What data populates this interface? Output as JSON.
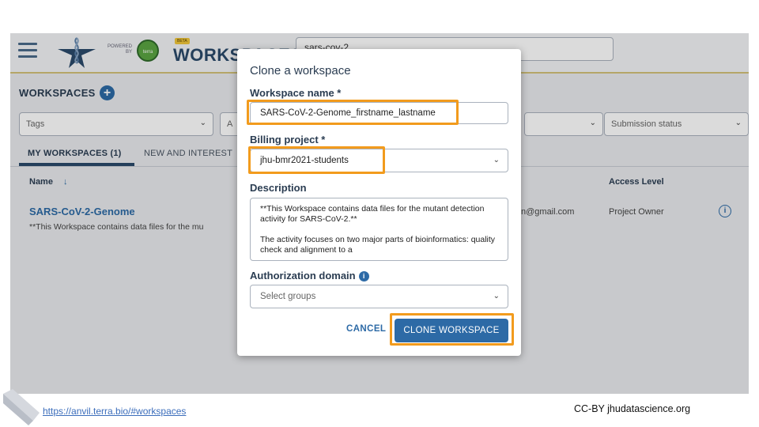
{
  "app": {
    "title": "WORKSPACES",
    "powered_by": "POWERED BY",
    "terra_badge": "terra",
    "beta_badge": "BETA",
    "search_value": "sars-cov-2"
  },
  "workspaces": {
    "heading": "WORKSPACES",
    "filters": [
      {
        "placeholder": "Tags"
      },
      {
        "placeholder": "A"
      },
      {
        "placeholder": ""
      },
      {
        "placeholder": "Submission status"
      }
    ],
    "tabs": [
      {
        "label": "MY WORKSPACES (1)",
        "active": true
      },
      {
        "label": "NEW AND INTEREST",
        "active": false
      }
    ],
    "columns": {
      "name": "Name",
      "sort_arrow": "↓",
      "access": "Access Level"
    },
    "row": {
      "name": "SARS-CoV-2-Genome",
      "description": "**This Workspace contains data files for the mu",
      "email": "n@gmail.com",
      "access": "Project Owner"
    }
  },
  "modal": {
    "title": "Clone a workspace",
    "workspace_name_label": "Workspace name *",
    "workspace_name_value": "SARS-CoV-2-Genome_firstname_lastname",
    "billing_label": "Billing project *",
    "billing_value": "jhu-bmr2021-students",
    "description_label": "Description",
    "description_p1": "**This Workspace contains data files for the mutant detection activity for SARS-CoV-2.**",
    "description_p2": "The activity focuses on two major parts of bioinformatics: quality check and alignment to a",
    "auth_label": "Authorization domain",
    "auth_placeholder": "Select groups",
    "cancel_label": "CANCEL",
    "clone_label": "CLONE WORKSPACE"
  },
  "footer": {
    "link": "https://anvil.terra.bio/#workspaces",
    "credit": "CC-BY  jhudatascience.org"
  },
  "colors": {
    "highlight": "#f29b1d",
    "primary_blue": "#2d6aa6",
    "navy_text": "#2b3d52"
  },
  "icons": [
    "menu-icon",
    "anvil-logo-icon",
    "add-workspace-icon",
    "chevron-down-icon",
    "info-icon",
    "sort-arrow-icon"
  ]
}
